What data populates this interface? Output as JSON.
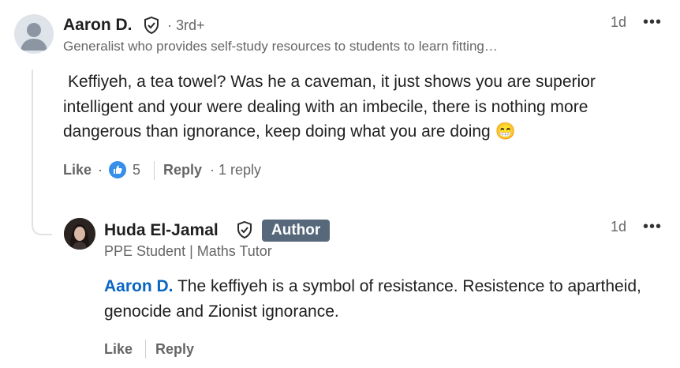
{
  "comment": {
    "author": {
      "name": "Aaron D.",
      "degree": "· 3rd+",
      "headline": "Generalist who provides self-study resources to students to learn fitting…",
      "verified_icon": "shield-check-icon"
    },
    "timestamp": "1d",
    "more_label": "•••",
    "text": "Keffiyeh, a tea towel? Was he a caveman, it just shows you are superior intelligent and your were dealing with an imbecile, there is nothing more dangerous than ignorance, keep doing what you are doing",
    "emoji": "😁",
    "like_label": "Like",
    "reaction_separator": "·",
    "reaction_icon": "thumbs-up-icon",
    "reaction_count": "5",
    "reply_label": "Reply",
    "replies_count": "· 1 reply"
  },
  "reply": {
    "author": {
      "name": "Huda El-Jamal",
      "badge": "Author",
      "headline": "PPE Student | Maths Tutor",
      "verified_icon": "shield-check-icon"
    },
    "timestamp": "1d",
    "more_label": "•••",
    "mention": "Aaron D.",
    "text": "The keffiyeh is a symbol of resistance. Resistence to apartheid, genocide and Zionist ignorance.",
    "like_label": "Like",
    "reply_label": "Reply"
  },
  "colors": {
    "link_blue": "#0a66c2",
    "badge_bg": "#56687a",
    "reaction_blue": "#378fe9"
  }
}
